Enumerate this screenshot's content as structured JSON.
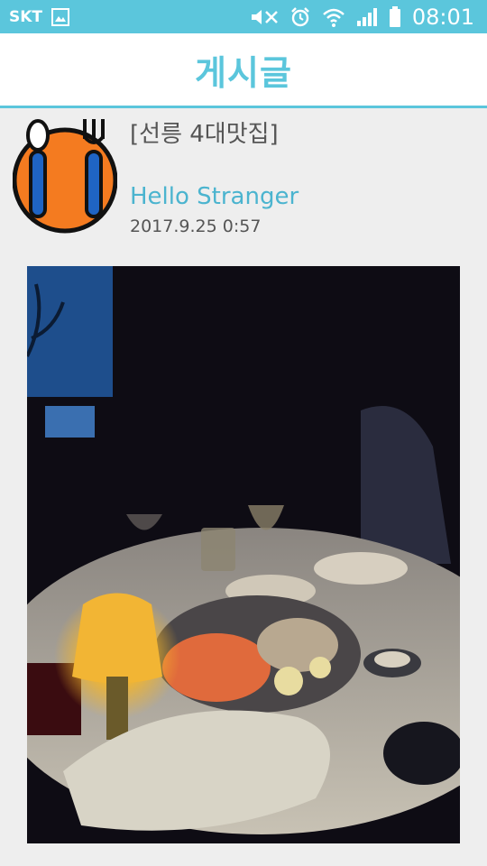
{
  "status_bar": {
    "carrier": "SKT",
    "time": "08:01",
    "icons": [
      "gallery-icon",
      "mute-icon",
      "alarm-icon",
      "wifi-icon",
      "signal-icon",
      "battery-icon"
    ]
  },
  "app_bar": {
    "title": "게시글"
  },
  "post": {
    "title": "[선릉 4대맛집]",
    "author": "Hello Stranger",
    "date": "2017.9.25 0:57",
    "avatar_icon": "restaurant-icon",
    "photo_description_icon": "dinner-photo"
  },
  "colors": {
    "accent": "#5bc6dc",
    "author_text": "#4bb4cf",
    "body_text": "#555555",
    "avatar_orange": "#f47b20"
  }
}
